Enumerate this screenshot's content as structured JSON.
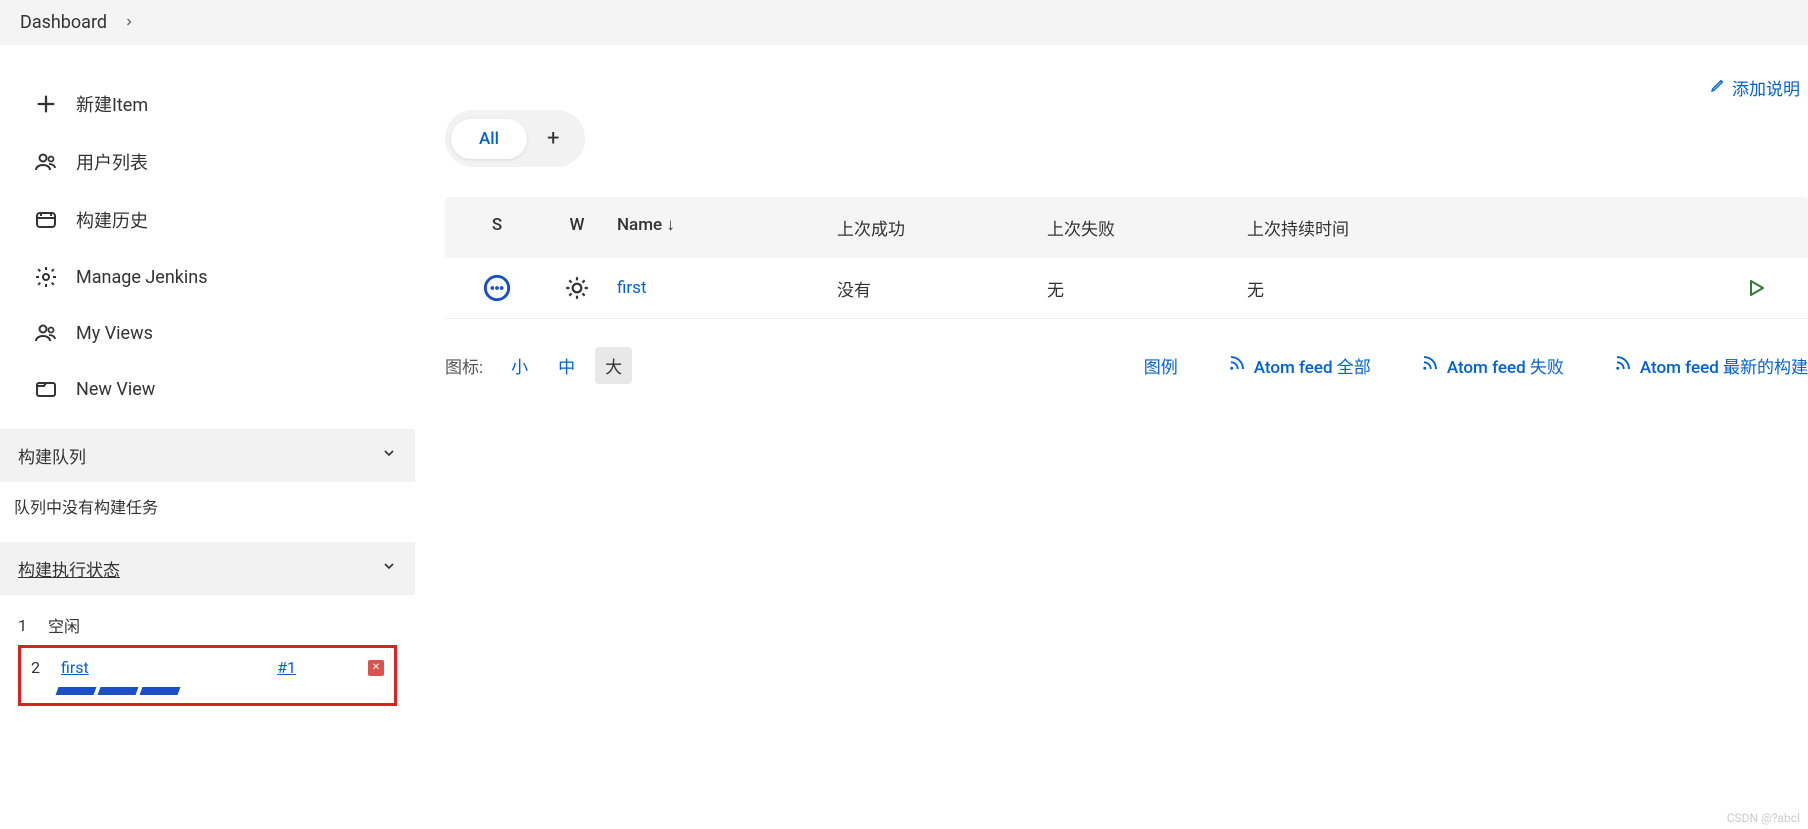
{
  "breadcrumb": {
    "items": [
      "Dashboard"
    ]
  },
  "sidebar": {
    "nav": [
      {
        "label": "新建Item",
        "icon": "plus-icon"
      },
      {
        "label": "用户列表",
        "icon": "people-icon"
      },
      {
        "label": "构建历史",
        "icon": "history-icon"
      },
      {
        "label": "Manage Jenkins",
        "icon": "gear-icon"
      },
      {
        "label": "My Views",
        "icon": "people-icon"
      },
      {
        "label": "New View",
        "icon": "folder-icon"
      }
    ],
    "build_queue": {
      "title": "构建队列",
      "empty_text": "队列中没有构建任务"
    },
    "executors": {
      "title": "构建执行状态",
      "rows": [
        {
          "num": "1",
          "label": "空闲"
        },
        {
          "num": "2",
          "job": "first",
          "build": "#1"
        }
      ]
    }
  },
  "main": {
    "add_description": "添加说明",
    "tabs": {
      "active": "All",
      "add": "+"
    },
    "table": {
      "headers": {
        "s": "S",
        "w": "W",
        "name": "Name ↓",
        "last_success": "上次成功",
        "last_failure": "上次失败",
        "last_duration": "上次持续时间"
      },
      "rows": [
        {
          "name": "first",
          "last_success": "没有",
          "last_failure": "无",
          "last_duration": "无"
        }
      ]
    },
    "footer": {
      "icon_label": "图标:",
      "sizes": {
        "small": "小",
        "medium": "中",
        "large": "大"
      },
      "legend": "图例",
      "feed_all": "Atom feed 全部",
      "feed_failed": "Atom feed 失败",
      "feed_latest": "Atom feed 最新的构建"
    }
  },
  "watermark": "CSDN @?abcl"
}
